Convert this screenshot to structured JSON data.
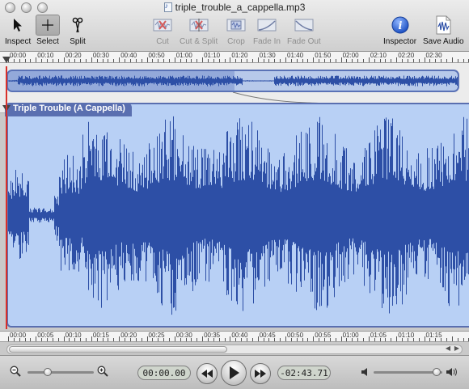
{
  "window": {
    "title": "triple_trouble_a_cappella.mp3"
  },
  "toolbar": {
    "inspect_label": "Inspect",
    "select_label": "Select",
    "split_label": "Split",
    "cut_label": "Cut",
    "cut_split_label": "Cut & Split",
    "crop_label": "Crop",
    "fade_in_label": "Fade In",
    "fade_out_label": "Fade Out",
    "inspector_label": "Inspector",
    "save_audio_label": "Save Audio"
  },
  "top_ruler": [
    "00:00",
    "00:10",
    "00:20",
    "00:30",
    "00:40",
    "00:50",
    "01:00",
    "01:10",
    "01:20",
    "01:30",
    "01:40",
    "01:50",
    "02:00",
    "02:10",
    "02:20",
    "02:30"
  ],
  "bottom_ruler": [
    "00:00",
    "00:05",
    "00:10",
    "00:15",
    "00:20",
    "00:25",
    "00:30",
    "00:35",
    "00:40",
    "00:45",
    "00:50",
    "00:55",
    "01:00",
    "01:05",
    "01:10",
    "01:15"
  ],
  "track": {
    "name": "Triple Trouble (A Cappella)"
  },
  "transport": {
    "current_time": "00:00.00",
    "remaining_time": "-02:43.71"
  },
  "icons": {
    "zoom_out": "magnifier-minus-icon",
    "zoom_in": "magnifier-plus-icon",
    "rewind": "rewind-icon",
    "play": "play-icon",
    "fast_forward": "fast-forward-icon",
    "volume": "speaker-icon"
  },
  "colors": {
    "waveform": "#2d4fa6",
    "track_bg": "#b8d0f5",
    "track_border": "#5a6fb0",
    "playhead": "#d9302a"
  }
}
